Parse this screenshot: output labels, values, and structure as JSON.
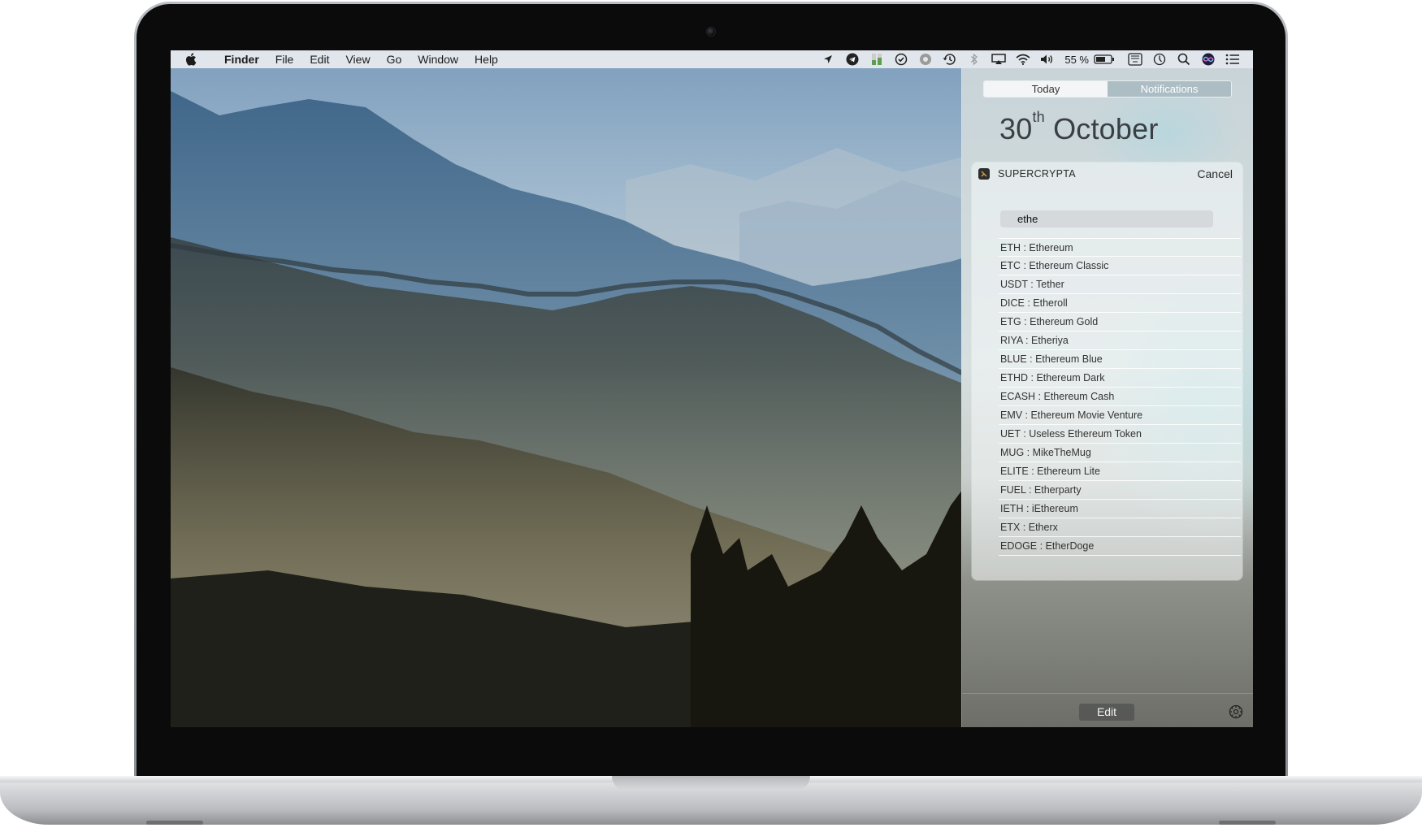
{
  "menubar": {
    "app_name": "Finder",
    "menus": [
      "File",
      "Edit",
      "View",
      "Go",
      "Window",
      "Help"
    ],
    "status_icons": [
      "location-icon",
      "telegram-icon",
      "stats-icon",
      "tasks-icon",
      "app-icon",
      "time-machine-icon",
      "bluetooth-icon",
      "airplay-icon",
      "wifi-icon",
      "volume-icon"
    ],
    "battery_percent": "55 %",
    "trailing_icons": [
      "keyboard-icon",
      "clock-icon",
      "spotlight-icon",
      "siri-icon",
      "notification-center-icon"
    ]
  },
  "notification_center": {
    "tabs": {
      "today": "Today",
      "notifications": "Notifications"
    },
    "date": {
      "day": "30",
      "suffix": "th",
      "month": "October"
    },
    "widget": {
      "title": "SUPERCRYPTA",
      "cancel_label": "Cancel",
      "search_value": "ethe",
      "results": [
        "ETH : Ethereum",
        "ETC : Ethereum Classic",
        "USDT : Tether",
        "DICE : Etheroll",
        "ETG : Ethereum Gold",
        "RIYA : Etheriya",
        "BLUE : Ethereum Blue",
        "ETHD : Ethereum Dark",
        "ECASH : Ethereum Cash",
        "EMV : Ethereum Movie Venture",
        "UET : Useless Ethereum Token",
        "MUG : MikeTheMug",
        "ELITE : Ethereum Lite",
        "FUEL : Etherparty",
        "IETH : iEthereum",
        "ETX : Etherx",
        "EDOGE : EtherDoge"
      ]
    },
    "footer": {
      "edit_label": "Edit"
    }
  }
}
